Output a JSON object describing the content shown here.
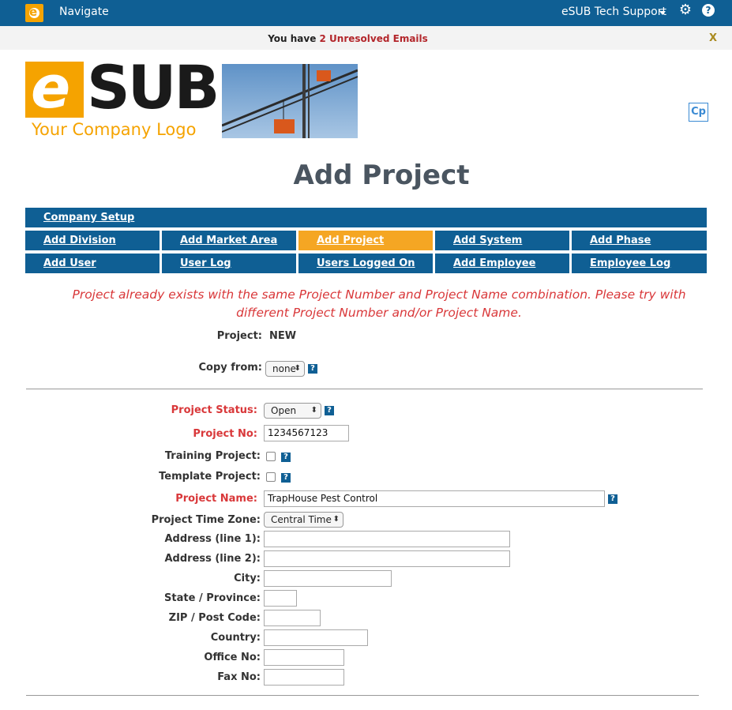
{
  "topbar": {
    "logo_letter": "e",
    "navigate_label": "Navigate",
    "support_label": "eSUB Tech Support",
    "gear_icon": "gear-icon",
    "help_icon": "question-icon",
    "help_glyph": "?"
  },
  "notice": {
    "prefix": "You have ",
    "emails_link": "2 Unresolved Emails",
    "close_label": "X"
  },
  "brand": {
    "letter": "e",
    "name": "SUB",
    "tagline": "Your Company Logo"
  },
  "cp_button": "Cp",
  "page_title": "Add Project",
  "nav": {
    "row1": [
      "Company Setup"
    ],
    "row2": [
      "Add Division",
      "Add Market Area",
      "Add Project",
      "Add System",
      "Add Phase"
    ],
    "row3": [
      "Add User",
      "User Log",
      "Users Logged On",
      "Add Employee",
      "Employee Log"
    ]
  },
  "error_message": "Project already exists with the same Project Number and Project Name combination. Please try with different Project Number and/or Project Name.",
  "form": {
    "project_label": "Project:",
    "project_value": "NEW",
    "copy_from_label": "Copy from:",
    "copy_from_value": "none",
    "status_label": "Project Status:",
    "status_value": "Open",
    "number_label": "Project No:",
    "number_value": "1234567123",
    "training_label": "Training Project:",
    "template_label": "Template Project:",
    "name_label": "Project Name:",
    "name_value": "TrapHouse Pest Control",
    "timezone_label": "Project Time Zone:",
    "timezone_value": "Central Time",
    "address1_label": "Address (line 1):",
    "address2_label": "Address (line 2):",
    "city_label": "City:",
    "state_label": "State / Province:",
    "zip_label": "ZIP / Post Code:",
    "country_label": "Country:",
    "office_label": "Office No:",
    "fax_label": "Fax No:",
    "help_glyph": "?"
  },
  "colors": {
    "primary": "#0f5f94",
    "accent": "#f5a623",
    "error": "#d9383a"
  }
}
